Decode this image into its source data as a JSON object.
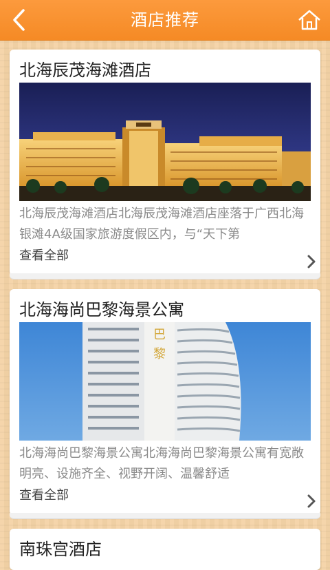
{
  "header": {
    "title": "酒店推荐",
    "back_icon": "back-arrow-icon",
    "home_icon": "home-icon"
  },
  "colors": {
    "accent": "#f7902c",
    "background": "#f4d3a6",
    "card": "#ffffff",
    "desc_text": "#8a8a8a"
  },
  "hotels": [
    {
      "name": "北海辰茂海滩酒店",
      "description": "北海辰茂海滩酒店北海辰茂海滩酒店座落于广西北海银滩4A级国家旅游度假区内，与“天下第",
      "link_label": "查看全部",
      "image_alt": "hotel-night-photo"
    },
    {
      "name": "北海海尚巴黎海景公寓",
      "description": "北海海尚巴黎海景公寓北海海尚巴黎海景公寓有宽敞明亮、设施齐全、视野开阔、温馨舒适",
      "link_label": "查看全部",
      "image_alt": "apartment-tower-photo",
      "sign_text": "巴黎"
    },
    {
      "name": "南珠宫酒店"
    }
  ]
}
